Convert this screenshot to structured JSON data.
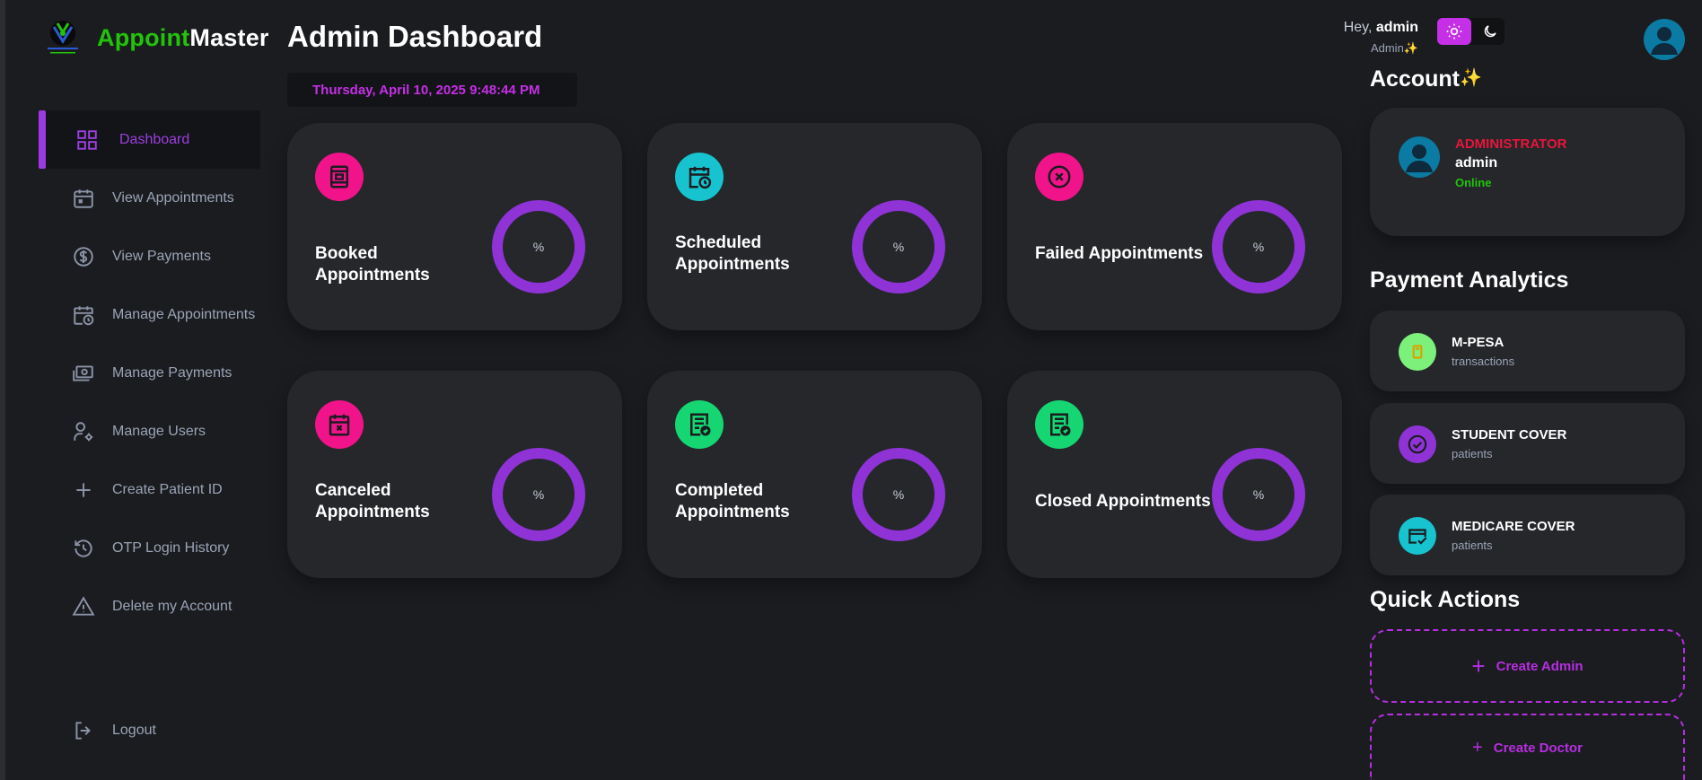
{
  "brand": {
    "name_part1": "Appoint",
    "name_part2": "Master"
  },
  "sidebar": {
    "items": [
      {
        "label": "Dashboard",
        "icon": "dashboard-grid-icon",
        "active": true
      },
      {
        "label": "View Appointments",
        "icon": "calendar-icon"
      },
      {
        "label": "View Payments",
        "icon": "dollar-circle-icon"
      },
      {
        "label": "Manage Appointments",
        "icon": "calendar-clock-icon"
      },
      {
        "label": "Manage Payments",
        "icon": "cash-icon"
      },
      {
        "label": "Manage Users",
        "icon": "user-gear-icon"
      },
      {
        "label": "Create Patient ID",
        "icon": "plus-icon"
      },
      {
        "label": "OTP Login History",
        "icon": "history-icon"
      },
      {
        "label": "Delete my Account",
        "icon": "warning-icon"
      }
    ],
    "logout_label": "Logout"
  },
  "main": {
    "title": "Admin Dashboard",
    "datetime": "Thursday, April 10, 2025 9:48:44 PM",
    "cards": [
      {
        "label": "Booked Appointments",
        "percent": "%",
        "icon": "booked-icon",
        "color": "#f0138a"
      },
      {
        "label": "Scheduled Appointments",
        "percent": "%",
        "icon": "calendar-clock-icon",
        "color": "#17c3cf"
      },
      {
        "label": "Failed Appointments",
        "percent": "%",
        "icon": "x-circle-icon",
        "color": "#f0138a"
      },
      {
        "label": "Canceled Appointments",
        "percent": "%",
        "icon": "calendar-x-icon",
        "color": "#f0138a"
      },
      {
        "label": "Completed Appointments",
        "percent": "%",
        "icon": "document-check-icon",
        "color": "#15d672"
      },
      {
        "label": "Closed Appointments",
        "percent": "%",
        "icon": "document-check-icon",
        "color": "#15d672"
      }
    ]
  },
  "header": {
    "greeting_prefix": "Hey,",
    "username": "admin",
    "role_line": "Admin✨"
  },
  "account": {
    "title": "Account",
    "sparkle": "✨",
    "role": "ADMINISTRATOR",
    "name": "admin",
    "status": "Online"
  },
  "payment_analytics": {
    "title": "Payment Analytics",
    "items": [
      {
        "name": "M-PESA",
        "sub": "transactions",
        "icon": "mpesa-icon",
        "color": "#7cf07a"
      },
      {
        "name": "STUDENT COVER",
        "sub": "patients",
        "icon": "check-circle-icon",
        "color": "#8f33d6"
      },
      {
        "name": "MEDICARE COVER",
        "sub": "patients",
        "icon": "card-check-icon",
        "color": "#17c3cf"
      }
    ]
  },
  "quick_actions": {
    "title": "Quick Actions",
    "create_admin": "Create Admin",
    "create_doctor": "Create Doctor",
    "plus": "+"
  }
}
